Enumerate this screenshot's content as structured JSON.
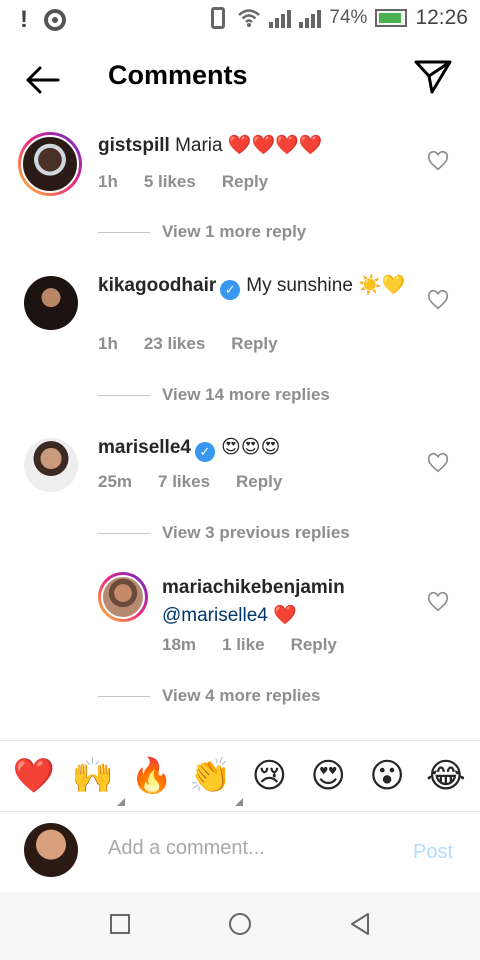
{
  "status_bar": {
    "battery": "74%",
    "time": "12:26",
    "icons": [
      "alert-icon",
      "disc-icon",
      "vibrate-icon",
      "wifi-icon",
      "signal-icon",
      "signal-icon",
      "battery-icon"
    ]
  },
  "header": {
    "title": "Comments",
    "back_icon": "arrow-left-icon",
    "send_icon": "send-icon"
  },
  "comments": [
    {
      "username": "gistspill",
      "text": "Maria",
      "emoji": "❤️❤️❤️❤️",
      "time": "1h",
      "likes": "5 likes",
      "reply": "Reply",
      "view_more": "View 1 more reply",
      "verified": false
    },
    {
      "username": "kikagoodhair",
      "text": "My sunshine",
      "emoji": "☀️💛",
      "time": "1h",
      "likes": "23 likes",
      "reply": "Reply",
      "view_more": "View 14 more replies",
      "verified": true
    },
    {
      "username": "mariselle4",
      "text": "",
      "emoji": "😍😍😍",
      "time": "25m",
      "likes": "7 likes",
      "reply": "Reply",
      "view_more": "View 3 previous replies",
      "verified": true
    }
  ],
  "reply": {
    "username": "mariachikebenjamin",
    "mention": "@mariselle4",
    "emoji": "❤️",
    "time": "18m",
    "likes": "1 like",
    "reply": "Reply",
    "view_more": "View 4 more replies"
  },
  "emoji_bar": [
    "❤️",
    "🙌",
    "🔥",
    "👏",
    "😢",
    "😍",
    "😮",
    "😂"
  ],
  "composer": {
    "placeholder": "Add a comment...",
    "post_label": "Post"
  },
  "colors": {
    "link": "#00376b",
    "verified": "#3897f0",
    "post_disabled": "#b3dbff",
    "secondary_text": "#8e8e8e"
  }
}
